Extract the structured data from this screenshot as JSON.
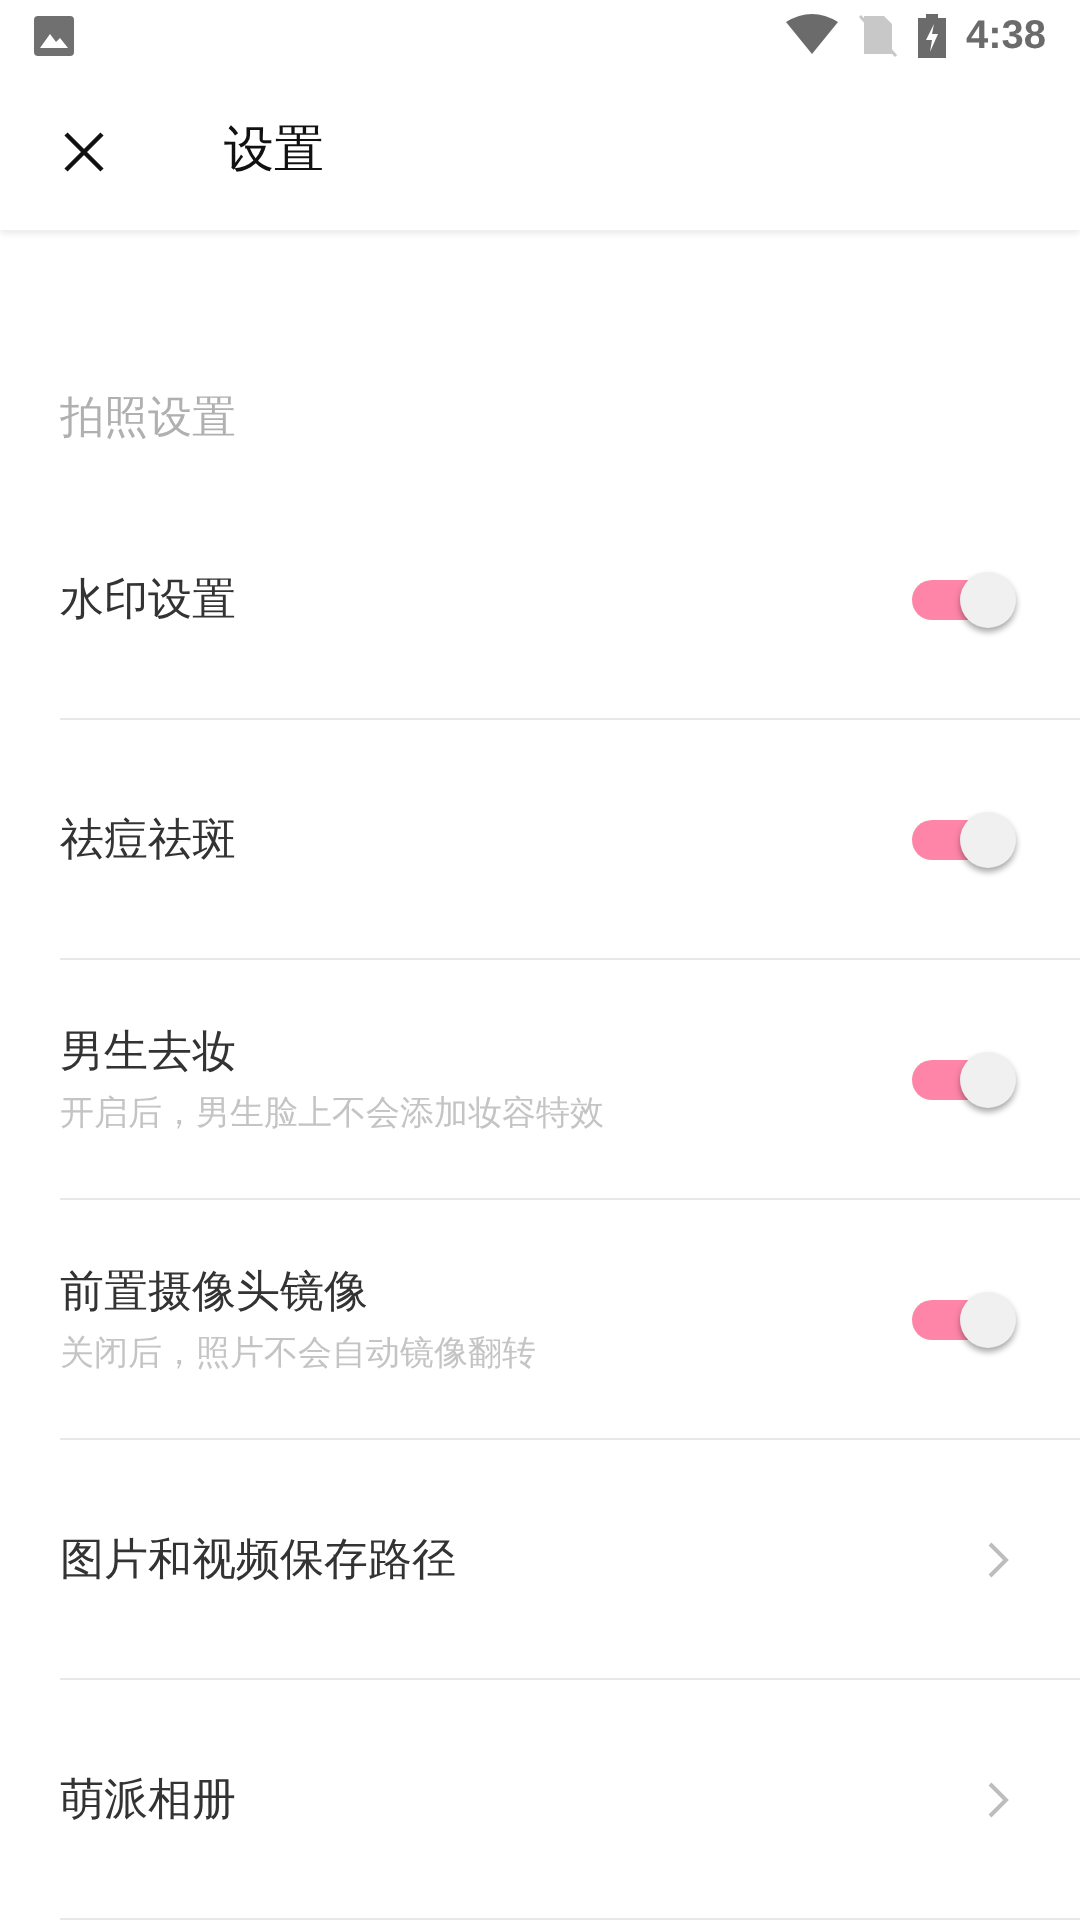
{
  "status_bar": {
    "time": "4:38"
  },
  "app_bar": {
    "title": "设置"
  },
  "section": {
    "title": "拍照设置"
  },
  "items": [
    {
      "kind": "toggle",
      "label": "水印设置",
      "on": true
    },
    {
      "kind": "toggle",
      "label": "祛痘祛斑",
      "on": true
    },
    {
      "kind": "toggle",
      "label": "男生去妆",
      "subtitle": "开启后，男生脸上不会添加妆容特效",
      "on": true
    },
    {
      "kind": "toggle",
      "label": "前置摄像头镜像",
      "subtitle": "关闭后，照片不会自动镜像翻转",
      "on": true
    },
    {
      "kind": "link",
      "label": "图片和视频保存路径"
    },
    {
      "kind": "link",
      "label": "萌派相册"
    }
  ]
}
